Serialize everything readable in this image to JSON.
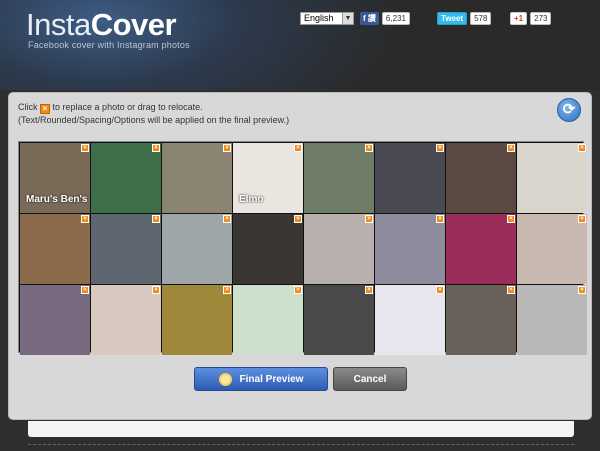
{
  "header": {
    "logo_light": "Insta",
    "logo_bold": "Cover",
    "tagline": "Facebook cover with Instagram photos",
    "language": "English",
    "facebook": {
      "label": "f 讚",
      "count": "6,231"
    },
    "twitter": {
      "label": "Tweet",
      "count": "578"
    },
    "gplus": {
      "label": "+1",
      "count": "273"
    }
  },
  "instructions": {
    "line1_before": "Click",
    "line1_after": "to replace a photo or drag to relocate.",
    "line2": "(Text/Rounded/Spacing/Options will be applied on the final preview.)"
  },
  "refresh_icon": "refresh-icon",
  "grid": {
    "rows": 3,
    "cols": 8,
    "remove_glyph": "×",
    "tiles": [
      {
        "bg": "#7a6a58",
        "caption": "Maru's Ben's"
      },
      {
        "bg": "#3f6e4a"
      },
      {
        "bg": "#8b8470"
      },
      {
        "bg": "#eae6df",
        "caption": "Elmo"
      },
      {
        "bg": "#6f7d66"
      },
      {
        "bg": "#4a4a55"
      },
      {
        "bg": "#5a4a42"
      },
      {
        "bg": "#d9d4cc"
      },
      {
        "bg": "#8a6a4a"
      },
      {
        "bg": "#5e6670"
      },
      {
        "bg": "#9ea6aa"
      },
      {
        "bg": "#3a3634"
      },
      {
        "bg": "#b8b0ad"
      },
      {
        "bg": "#8e8c9c"
      },
      {
        "bg": "#9b2d5a"
      },
      {
        "bg": "#c8b8b0"
      },
      {
        "bg": "#7a6a80"
      },
      {
        "bg": "#d8c8c0"
      },
      {
        "bg": "#a0883a"
      },
      {
        "bg": "#cde0cc"
      },
      {
        "bg": "#4a4a4a"
      },
      {
        "bg": "#e6e6ee"
      },
      {
        "bg": "#6a625a"
      },
      {
        "bg": "#b8b8b8"
      }
    ]
  },
  "buttons": {
    "final_preview": "Final Preview",
    "cancel": "Cancel"
  },
  "colors": {
    "accent_blue": "#2d5cb3",
    "remove_orange": "#f08a1a"
  }
}
